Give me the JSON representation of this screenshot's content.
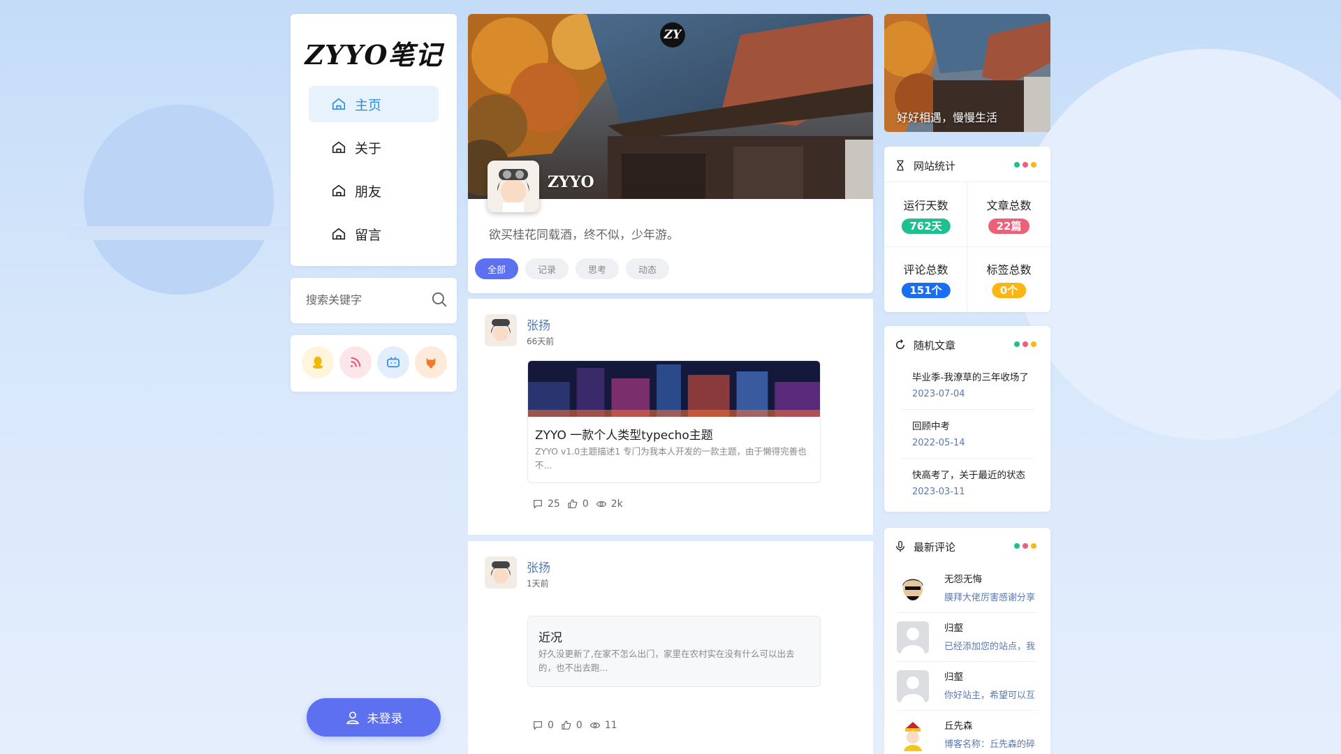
{
  "site": {
    "logo": "ZYYO笔记"
  },
  "nav": {
    "items": [
      {
        "label": "主页",
        "active": true
      },
      {
        "label": "关于",
        "active": false
      },
      {
        "label": "朋友",
        "active": false
      },
      {
        "label": "留言",
        "active": false
      }
    ]
  },
  "search": {
    "placeholder": "搜索关键字"
  },
  "social": [
    {
      "icon": "qq-icon",
      "color": "#f5b800"
    },
    {
      "icon": "rss-icon",
      "color": "#e8576e"
    },
    {
      "icon": "bilibili-icon",
      "color": "#3b8fe6"
    },
    {
      "icon": "github-icon",
      "color": "#f07a28"
    }
  ],
  "login": {
    "label": "未登录"
  },
  "profile": {
    "badge": "ZY",
    "name": "ZYYO",
    "motto": "欲买桂花同载酒，终不似，少年游。"
  },
  "tabs": [
    {
      "label": "全部",
      "active": true
    },
    {
      "label": "记录",
      "active": false
    },
    {
      "label": "思考",
      "active": false
    },
    {
      "label": "动态",
      "active": false
    }
  ],
  "posts": [
    {
      "author": "张扬",
      "time": "66天前",
      "title": "ZYYO 一款个人类型typecho主题",
      "desc": "ZYYO v1.0主题描述1 专门为我本人开发的一款主题，由于懒得完善也不...",
      "comments": "25",
      "likes": "0",
      "views": "2k"
    },
    {
      "author": "张扬",
      "time": "1天前",
      "title": "近况",
      "desc": "好久没更新了,在家不怎么出门，家里在农村实在没有什么可以出去的，也不出去跑...",
      "comments": "0",
      "likes": "0",
      "views": "11"
    }
  ],
  "right_banner": {
    "text": "好好相遇，慢慢生活"
  },
  "stats": {
    "title": "网站统计",
    "items": [
      {
        "label": "运行天数",
        "value": "762天",
        "color": "#1fbf8f"
      },
      {
        "label": "文章总数",
        "value": "22篇",
        "color": "#ee5f7a"
      },
      {
        "label": "评论总数",
        "value": "151个",
        "color": "#1a6ff0"
      },
      {
        "label": "标签总数",
        "value": "0个",
        "color": "#fbb614"
      }
    ]
  },
  "random": {
    "title": "随机文章",
    "items": [
      {
        "title": "毕业季-我潦草的三年收场了",
        "date": "2023-07-04"
      },
      {
        "title": "回顾中考",
        "date": "2022-05-14"
      },
      {
        "title": "快高考了，关于最近的状态",
        "date": "2023-03-11"
      }
    ]
  },
  "comments": {
    "title": "最新评论",
    "items": [
      {
        "name": "无怨无悔",
        "text": "膜拜大佬厉害感谢分享"
      },
      {
        "name": "归壑",
        "text": "已经添加您的站点，我"
      },
      {
        "name": "归壑",
        "text": "你好站主，希望可以互"
      },
      {
        "name": "丘先森",
        "text": "博客名称：丘先森的碎"
      }
    ]
  },
  "colors": {
    "accent": "#5d71f0",
    "nav_active": "#2b8fe0",
    "dot1": "#1fbf8f",
    "dot2": "#ee5f7a",
    "dot3": "#fbb614"
  }
}
